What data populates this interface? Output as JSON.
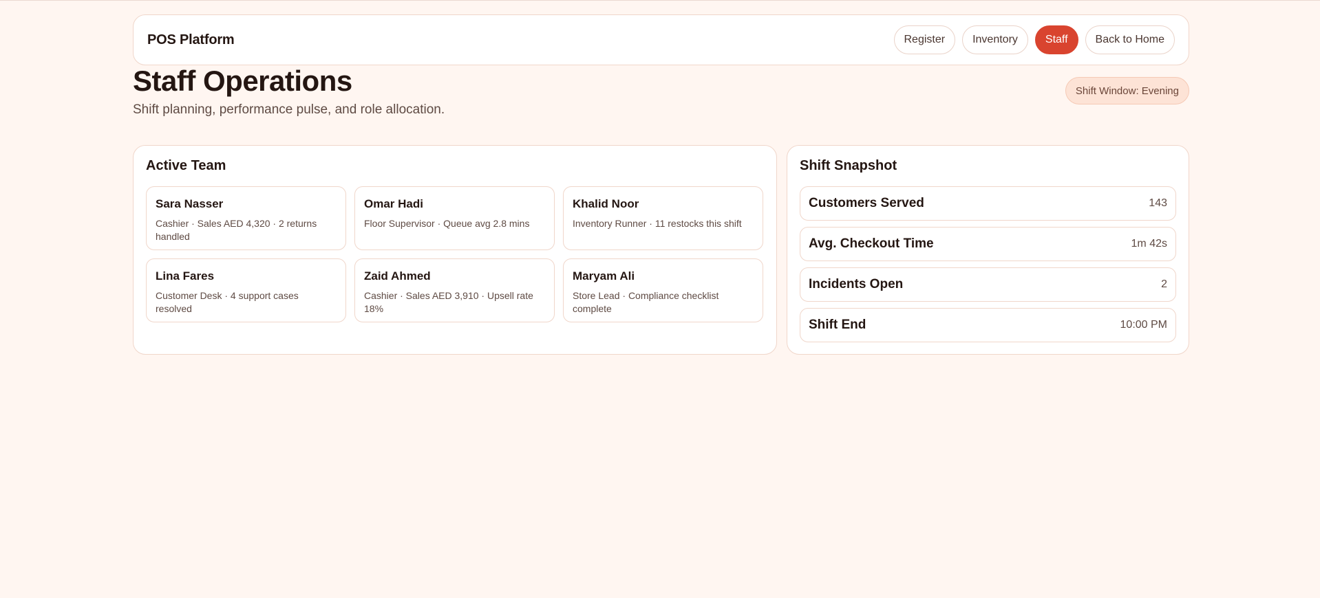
{
  "app": {
    "brand": "POS Platform"
  },
  "nav": {
    "items": [
      {
        "label": "Register",
        "active": false
      },
      {
        "label": "Inventory",
        "active": false
      },
      {
        "label": "Staff",
        "active": true
      },
      {
        "label": "Back to Home",
        "active": false
      }
    ]
  },
  "page": {
    "title": "Staff Operations",
    "subtitle": "Shift planning, performance pulse, and role allocation.",
    "shift_window": "Shift Window: Evening"
  },
  "team": {
    "title": "Active Team",
    "members": [
      {
        "name": "Sara Nasser",
        "meta": "Cashier · Sales AED 4,320 · 2 returns handled"
      },
      {
        "name": "Omar Hadi",
        "meta": "Floor Supervisor · Queue avg 2.8 mins"
      },
      {
        "name": "Khalid Noor",
        "meta": "Inventory Runner · 11 restocks this shift"
      },
      {
        "name": "Lina Fares",
        "meta": "Customer Desk · 4 support cases resolved"
      },
      {
        "name": "Zaid Ahmed",
        "meta": "Cashier · Sales AED 3,910 · Upsell rate 18%"
      },
      {
        "name": "Maryam Ali",
        "meta": "Store Lead · Compliance checklist complete"
      }
    ]
  },
  "snapshot": {
    "title": "Shift Snapshot",
    "stats": [
      {
        "label": "Customers Served",
        "value": "143"
      },
      {
        "label": "Avg. Checkout Time",
        "value": "1m 42s"
      },
      {
        "label": "Incidents Open",
        "value": "2"
      },
      {
        "label": "Shift End",
        "value": "10:00 PM"
      }
    ]
  },
  "colors": {
    "background": "#fff6f1",
    "accent": "#d9442f",
    "pill_bg": "#fde3d6"
  }
}
